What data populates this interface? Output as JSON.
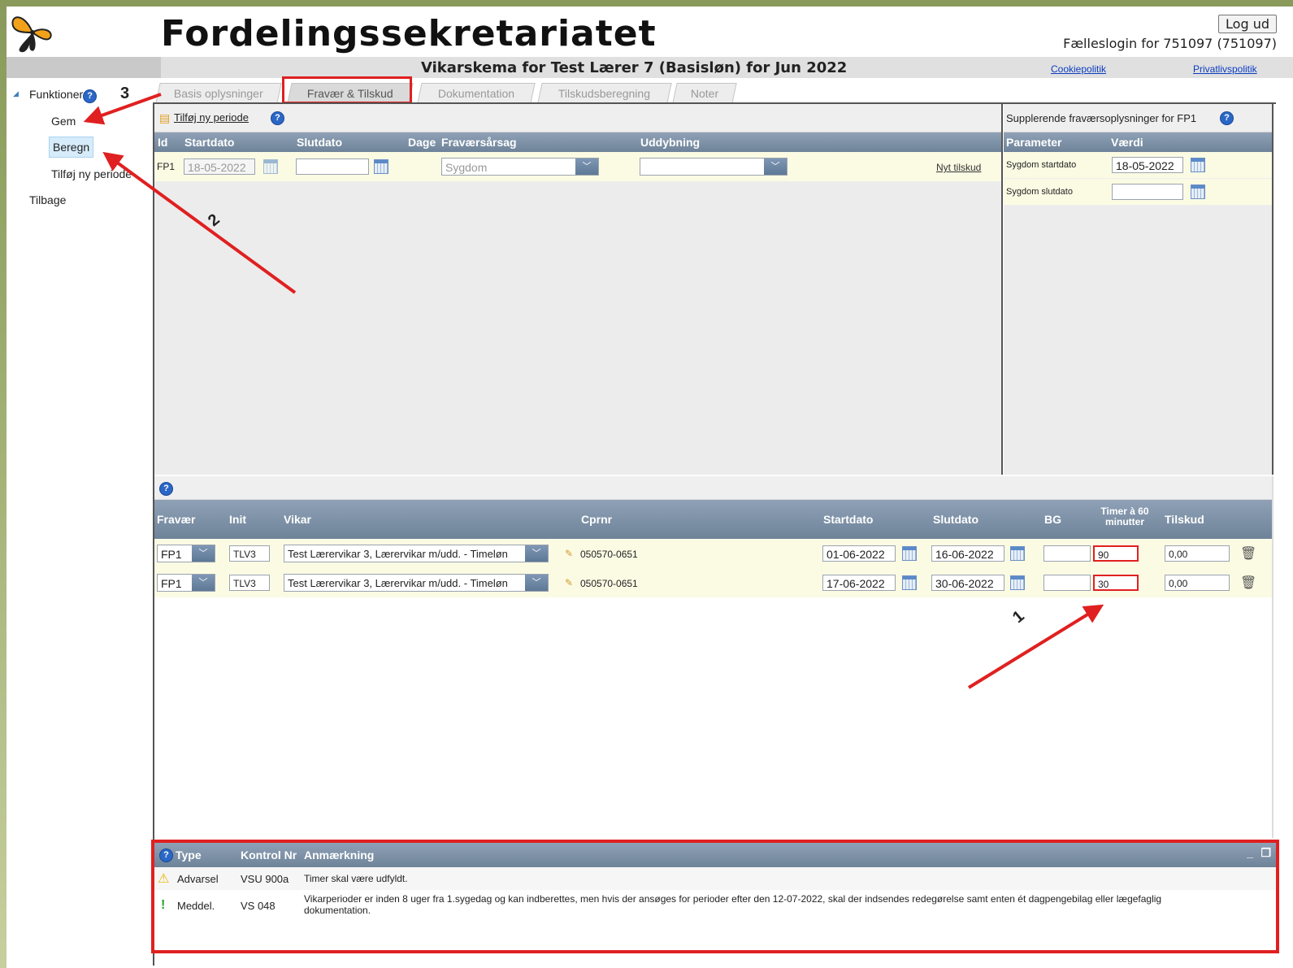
{
  "header": {
    "app_title": "Fordelingssekretariatet",
    "logout_label": "Log ud",
    "login_info": "Fælleslogin for 751097 (751097)",
    "subtitle": "Vikarskema for Test Lærer 7 (Basisløn) for Jun 2022",
    "cookie_link": "Cookiepolitik",
    "privacy_link": "Privatlivspolitik"
  },
  "sidebar": {
    "section_title": "Funktioner",
    "items": [
      "Gem",
      "Beregn",
      "Tilføj ny periode"
    ],
    "back_label": "Tilbage"
  },
  "tabs": [
    "Basis oplysninger",
    "Fravær & Tilskud",
    "Dokumentation",
    "Tilskudsberegning",
    "Noter"
  ],
  "annotations": [
    "1",
    "2",
    "3"
  ],
  "absence": {
    "add_period_label": "Tilføj ny periode",
    "columns": [
      "Id",
      "Startdato",
      "Slutdato",
      "Dage",
      "Fraværsårsag",
      "Uddybning"
    ],
    "rows": [
      {
        "id": "FP1",
        "start": "18-05-2022",
        "end": "",
        "days": "",
        "reason": "Sygdom",
        "detail": "",
        "link": "Nyt tilskud"
      }
    ]
  },
  "supplementary": {
    "title": "Supplerende fraværsoplysninger for FP1",
    "columns": [
      "Parameter",
      "Værdi"
    ],
    "rows": [
      {
        "param": "Sygdom startdato",
        "value": "18-05-2022"
      },
      {
        "param": "Sygdom slutdato",
        "value": ""
      }
    ]
  },
  "substitutes": {
    "columns": [
      "Fravær",
      "Init",
      "Vikar",
      "Cprnr",
      "Startdato",
      "Slutdato",
      "BG",
      "Timer à 60 minutter",
      "Tilskud"
    ],
    "rows": [
      {
        "fravaer": "FP1",
        "init": "TLV3",
        "vikar": "Test Lærervikar 3, Lærervikar m/udd. - Timeløn",
        "cpr": "050570-0651",
        "start": "01-06-2022",
        "end": "16-06-2022",
        "bg": "",
        "timer": "90",
        "tilskud": "0,00"
      },
      {
        "fravaer": "FP1",
        "init": "TLV3",
        "vikar": "Test Lærervikar 3, Lærervikar m/udd. - Timeløn",
        "cpr": "050570-0651",
        "start": "17-06-2022",
        "end": "30-06-2022",
        "bg": "",
        "timer": "30",
        "tilskud": "0,00"
      }
    ]
  },
  "messages": {
    "columns": [
      "Type",
      "Kontrol Nr",
      "Anmærkning"
    ],
    "rows": [
      {
        "type": "Advarsel",
        "code": "VSU 900a",
        "text": "Timer skal være udfyldt."
      },
      {
        "type": "Meddel.",
        "code": "VS 048",
        "text": "Vikarperioder er inden 8 uger fra 1.sygedag og kan indberettes, men hvis der ansøges for perioder efter den 12-07-2022, skal der indsendes redegørelse samt enten ét dagpengebilag eller lægefaglig dokumentation."
      }
    ]
  },
  "colors": {
    "accent_red": "#e02020",
    "header_blue": "#7a8ea5",
    "row_yellow": "#fbfbe4"
  }
}
